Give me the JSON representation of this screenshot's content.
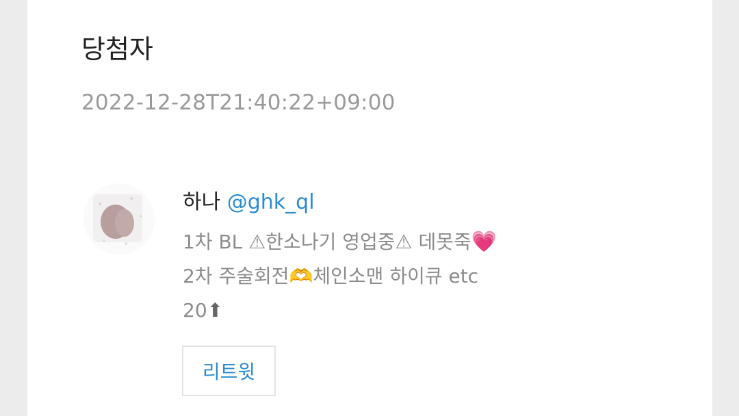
{
  "card": {
    "title": "당첨자",
    "timestamp": "2022-12-28T21:40:22+09:00"
  },
  "winner": {
    "name": "하나",
    "handle": "@ghk_ql",
    "avatar_icon": "profile-avatar",
    "bio": {
      "line1_pre": "1차 BL ",
      "warning_icon": "⚠",
      "line1_mid": "한소나기 영업중",
      "line1_post": " 데못죽",
      "heart_emoji": "💗",
      "line2_pre": "2차 주술회전",
      "hands_emoji": "🫶",
      "line2_post": "체인소맨 하이큐 etc",
      "line3_pre": "20",
      "up_arrow_emoji": "⬆"
    }
  },
  "actions": {
    "retweet_label": "리트윗"
  },
  "colors": {
    "link": "#2a8bd3",
    "title": "#222222",
    "muted": "#9a9a9a",
    "background": "#ececec",
    "card": "#ffffff"
  }
}
